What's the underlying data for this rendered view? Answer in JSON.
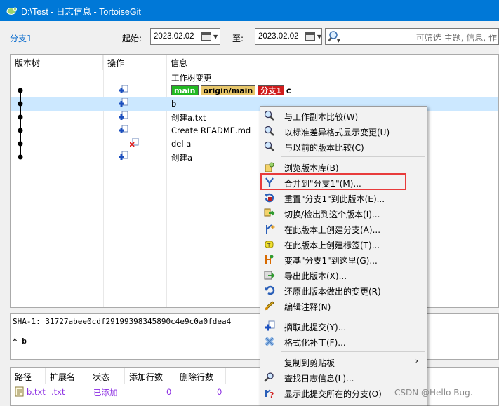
{
  "window": {
    "title": "D:\\Test - 日志信息 - TortoiseGit"
  },
  "filter": {
    "branch": "分支1",
    "from_label": "起始:",
    "from_date": "2023.02.02",
    "to_label": "至:",
    "to_date": "2023.02.02",
    "search_placeholder": "可筛选 主题, 信息, 作"
  },
  "log": {
    "columns": [
      "版本树",
      "操作",
      "信息"
    ],
    "rows": [
      {
        "message": "工作树变更"
      },
      {
        "tags": [
          "main",
          "origin/main",
          "分支1"
        ],
        "message": "c"
      },
      {
        "message": "b"
      },
      {
        "message": "创建a.txt"
      },
      {
        "message": "Create README.md"
      },
      {
        "message": "del a"
      },
      {
        "message": "创建a"
      }
    ]
  },
  "detail": {
    "sha": "SHA-1: 31727abee0cdf29199398345890c4e9c0a0fdea4",
    "subject": "* b"
  },
  "files": {
    "columns": [
      "路径",
      "扩展名",
      "状态",
      "添加行数",
      "删除行数"
    ],
    "row": {
      "path": "b.txt",
      "ext": ".txt",
      "status": "已添加",
      "added": "0",
      "deleted": "0"
    }
  },
  "menu": {
    "items": [
      {
        "label": "与工作副本比较(W)",
        "icon": "compare-icon"
      },
      {
        "label": "以标准差异格式显示变更(U)",
        "icon": "diff-icon"
      },
      {
        "label": "与以前的版本比较(C)",
        "icon": "compare-previous-icon"
      },
      {
        "label": "浏览版本库(B)",
        "icon": "repo-browser-icon"
      },
      {
        "label": "合并到\"分支1\"(M)...",
        "icon": "merge-icon"
      },
      {
        "label": "重置\"分支1\"到此版本(E)...",
        "icon": "reset-icon"
      },
      {
        "label": "切换/检出到这个版本(I)...",
        "icon": "switch-icon"
      },
      {
        "label": "在此版本上创建分支(A)...",
        "icon": "create-branch-icon"
      },
      {
        "label": "在此版本上创建标签(T)...",
        "icon": "create-tag-icon"
      },
      {
        "label": "变基\"分支1\"到这里(G)...",
        "icon": "rebase-icon"
      },
      {
        "label": "导出此版本(X)...",
        "icon": "export-icon"
      },
      {
        "label": "还原此版本做出的变更(R)",
        "icon": "revert-icon"
      },
      {
        "label": "编辑注释(N)",
        "icon": "edit-note-icon"
      },
      {
        "label": "摘取此提交(Y)...",
        "icon": "cherry-pick-icon"
      },
      {
        "label": "格式化补丁(F)...",
        "icon": "format-patch-icon"
      },
      {
        "label": "复制到剪贴板",
        "icon": "",
        "submenu": true
      },
      {
        "label": "查找日志信息(L)...",
        "icon": "find-icon"
      },
      {
        "label": "显示此提交所在的分支(O)",
        "icon": "branches-icon"
      }
    ]
  },
  "watermark": "CSDN @Hello Bug.",
  "colors": {
    "titlebar": "#0078d7",
    "selection": "#cce8ff",
    "highlight_box": "#e83b3b",
    "main_tag": "#22b922",
    "origin_tag": "#e8c76b",
    "branch_tag": "#d01c1c"
  }
}
